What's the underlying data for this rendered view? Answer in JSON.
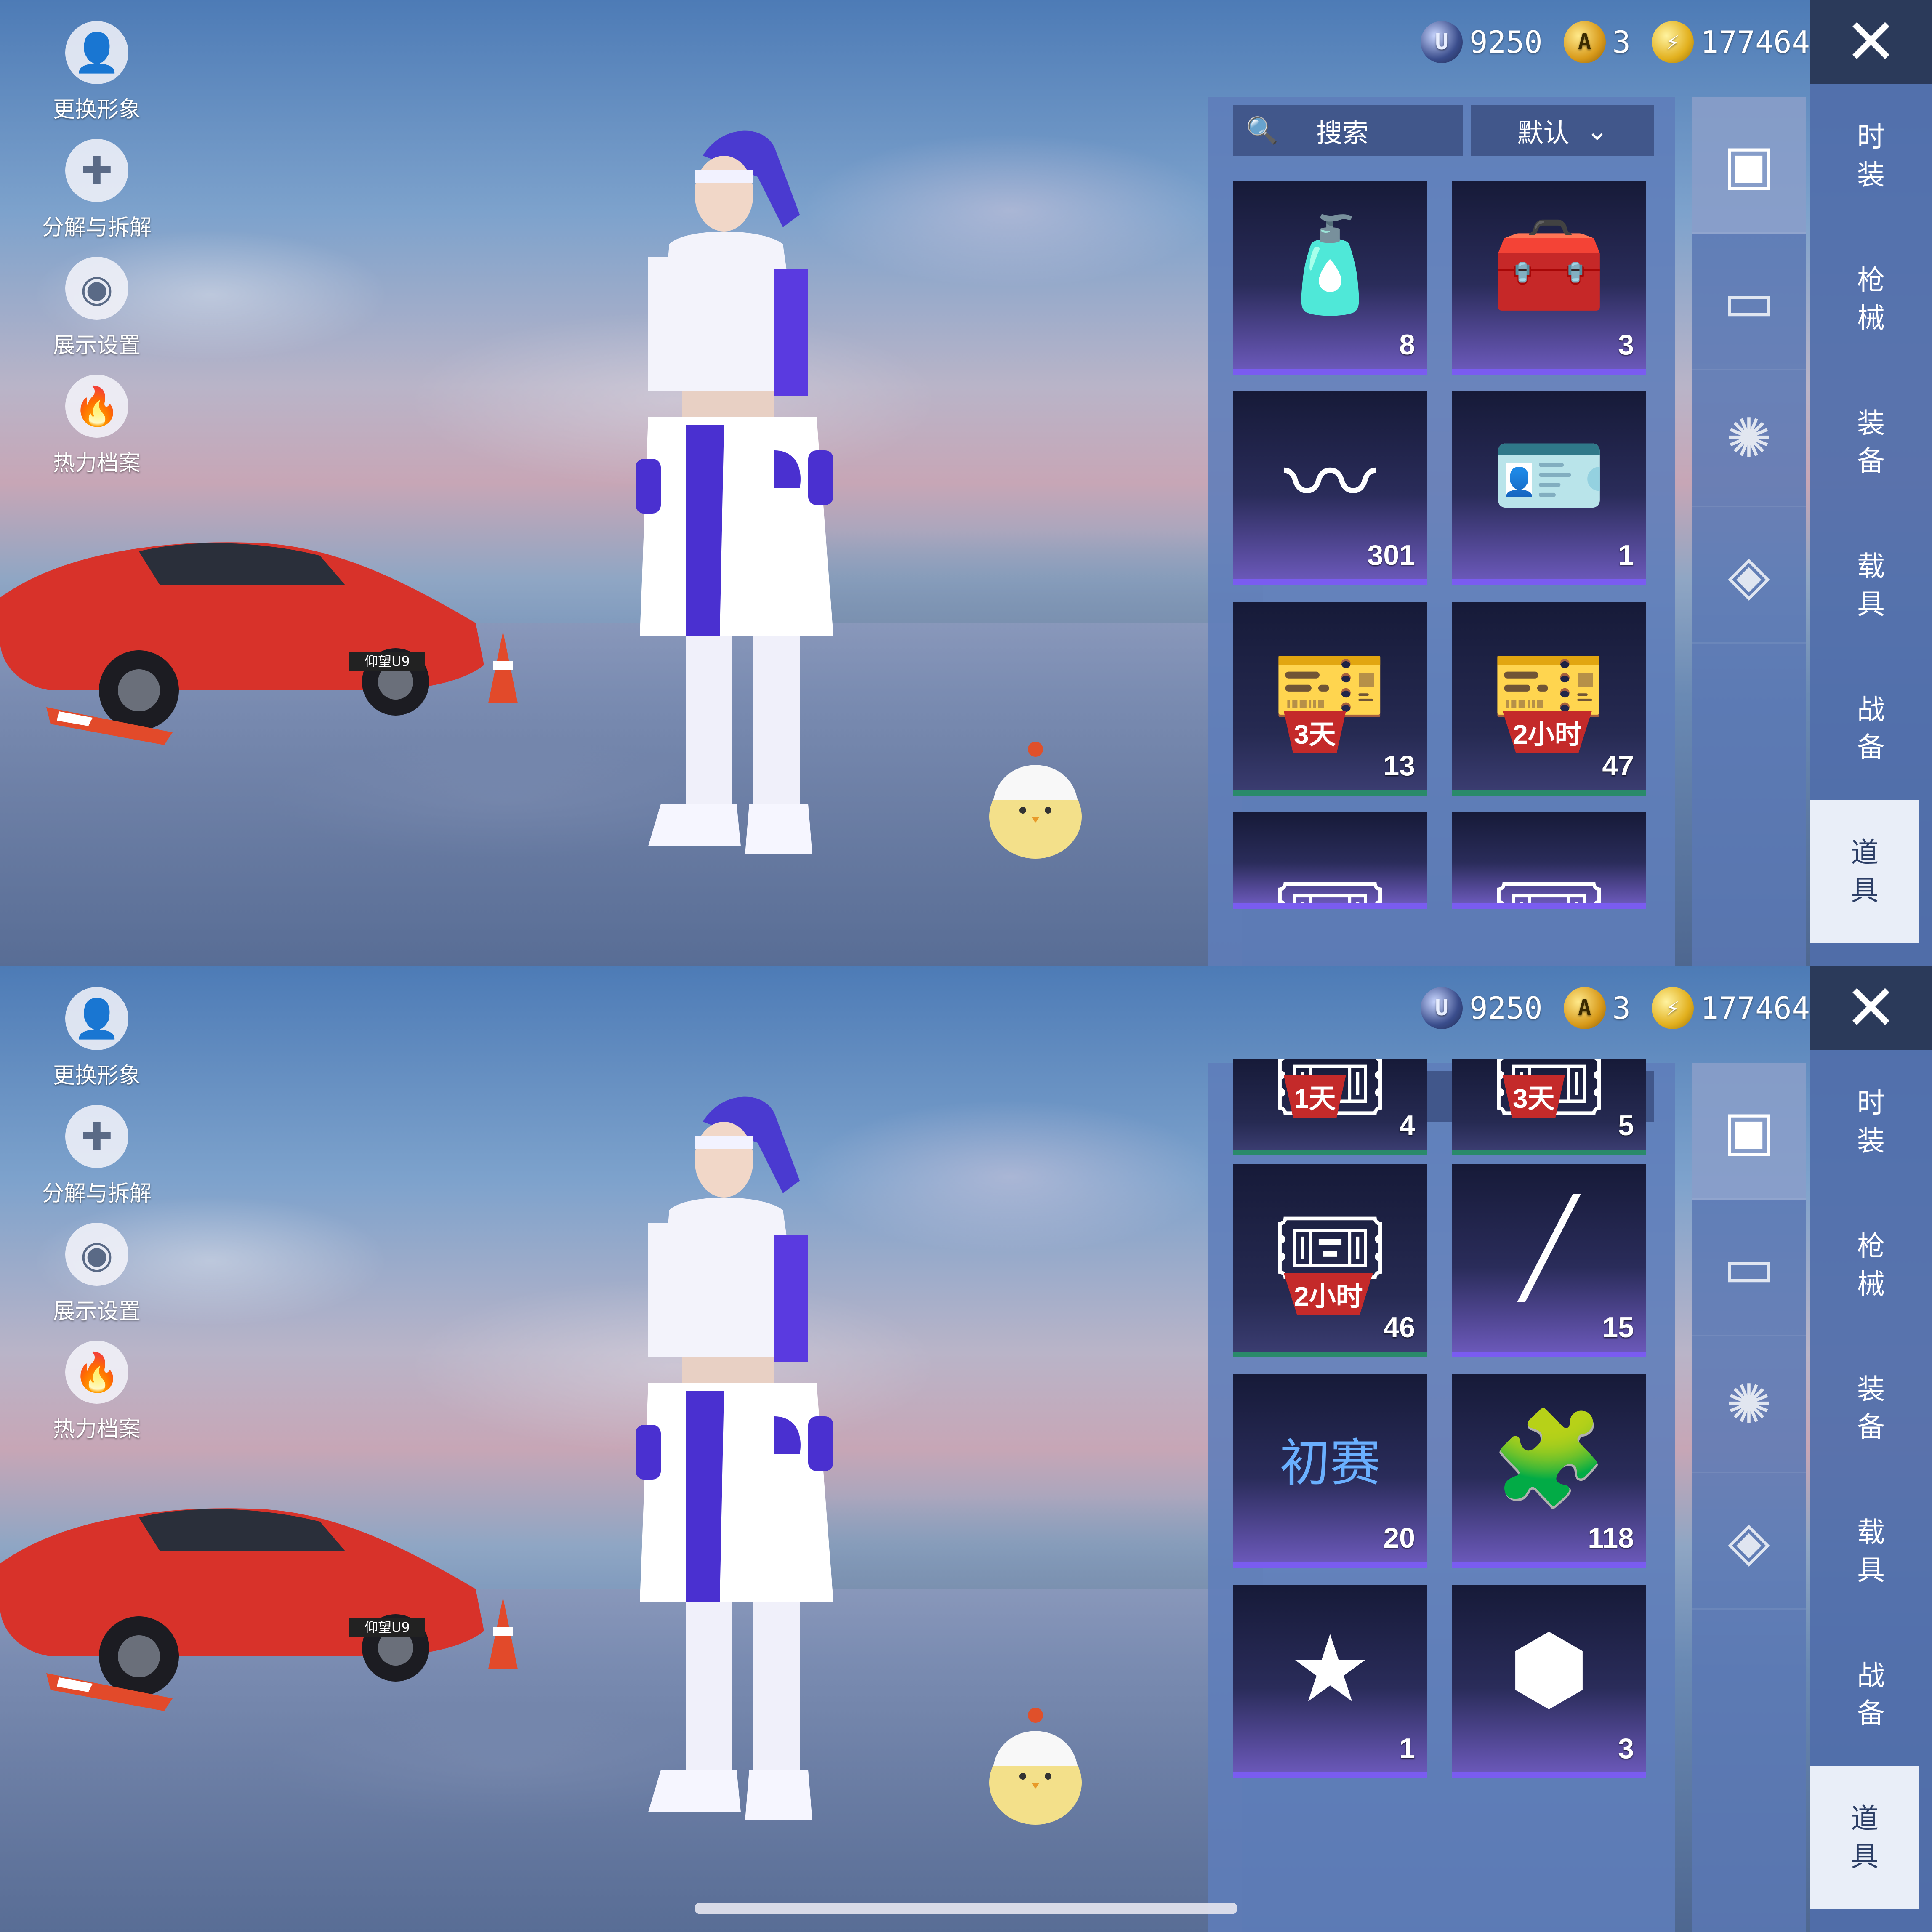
{
  "currencies": [
    {
      "icon": "uc-coin-icon",
      "value": "9250"
    },
    {
      "icon": "ag-coin-icon",
      "value": "3"
    },
    {
      "icon": "bp-coin-icon",
      "value": "177464"
    }
  ],
  "left_menu": [
    {
      "icon": "avatar-icon",
      "label": "更换形象"
    },
    {
      "icon": "puzzle-icon",
      "label": "分解与拆解"
    },
    {
      "icon": "eye-icon",
      "label": "展示设置"
    },
    {
      "icon": "fire-icon",
      "label": "热力档案"
    }
  ],
  "car_plate": "仰望U9",
  "categories": [
    {
      "label_1": "时",
      "label_2": "装"
    },
    {
      "label_1": "枪",
      "label_2": "械"
    },
    {
      "label_1": "装",
      "label_2": "备"
    },
    {
      "label_1": "载",
      "label_2": "具"
    },
    {
      "label_1": "战",
      "label_2": "备"
    },
    {
      "label_1": "道",
      "label_2": "具"
    }
  ],
  "sub_tabs": [
    "card-icon",
    "chest-icon",
    "firework-icon",
    "ticket-icon"
  ],
  "search": {
    "label": "搜索",
    "sort": "默认"
  },
  "top_items": [
    {
      "icon": "spray-can-icon",
      "qty": "8"
    },
    {
      "icon": "toolbox-icon",
      "qty": "3"
    },
    {
      "icon": "spring-icon",
      "qty": "301"
    },
    {
      "icon": "id-card-icon",
      "qty": "1"
    },
    {
      "icon": "exp-card-icon",
      "tag": "3天",
      "qty": "13"
    },
    {
      "icon": "exp-card-icon",
      "tag": "2小时",
      "qty": "47"
    },
    {
      "icon": "bp-card-icon",
      "qty": ""
    },
    {
      "icon": "bp-card-icon",
      "qty": ""
    }
  ],
  "bottom_items": [
    {
      "icon": "bp-card-icon",
      "tag": "1天",
      "qty": "4"
    },
    {
      "icon": "bp-card-icon",
      "tag": "3天",
      "qty": "5"
    },
    {
      "icon": "bp-card-icon",
      "tag": "2小时",
      "qty": "46"
    },
    {
      "icon": "stick-icon",
      "qty": "15"
    },
    {
      "icon": "ticket-icon",
      "ticket_text": "初赛",
      "qty": "20"
    },
    {
      "icon": "puzzle-orb-icon",
      "qty": "118"
    },
    {
      "icon": "star-badge-icon",
      "qty": "1"
    },
    {
      "icon": "nut-icon",
      "qty": "3"
    }
  ],
  "colors": {
    "rarity_purple": "#7a5cf0",
    "rarity_green": "#2a8a6a",
    "tag_red": "#c42a2a"
  }
}
